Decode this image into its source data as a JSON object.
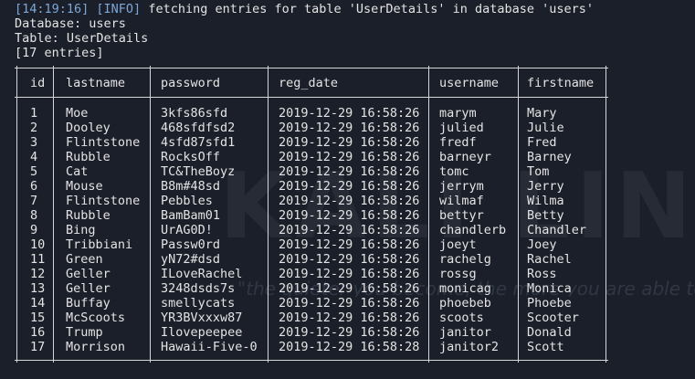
{
  "log": {
    "timestamp": "[14:19:16]",
    "level": "[INFO]",
    "message": "fetching entries for table 'UserDetails' in database 'users'"
  },
  "database_line": "Database: users",
  "table_line": "Table: UserDetails",
  "entries_line": "[17 entries]",
  "table": {
    "headers": [
      "id",
      "lastname",
      "password",
      "reg_date",
      "username",
      "firstname"
    ],
    "rows": [
      [
        "1",
        "Moe",
        "3kfs86sfd",
        "2019-12-29 16:58:26",
        "marym",
        "Mary"
      ],
      [
        "2",
        "Dooley",
        "468sfdfsd2",
        "2019-12-29 16:58:26",
        "julied",
        "Julie"
      ],
      [
        "3",
        "Flintstone",
        "4sfd87sfd1",
        "2019-12-29 16:58:26",
        "fredf",
        "Fred"
      ],
      [
        "4",
        "Rubble",
        "RocksOff",
        "2019-12-29 16:58:26",
        "barneyr",
        "Barney"
      ],
      [
        "5",
        "Cat",
        "TC&TheBoyz",
        "2019-12-29 16:58:26",
        "tomc",
        "Tom"
      ],
      [
        "6",
        "Mouse",
        "B8m#48sd",
        "2019-12-29 16:58:26",
        "jerrym",
        "Jerry"
      ],
      [
        "7",
        "Flintstone",
        "Pebbles",
        "2019-12-29 16:58:26",
        "wilmaf",
        "Wilma"
      ],
      [
        "8",
        "Rubble",
        "BamBam01",
        "2019-12-29 16:58:26",
        "bettyr",
        "Betty"
      ],
      [
        "9",
        "Bing",
        "UrAG0D!",
        "2019-12-29 16:58:26",
        "chandlerb",
        "Chandler"
      ],
      [
        "10",
        "Tribbiani",
        "Passw0rd",
        "2019-12-29 16:58:26",
        "joeyt",
        "Joey"
      ],
      [
        "11",
        "Green",
        "yN72#dsd",
        "2019-12-29 16:58:26",
        "rachelg",
        "Rachel"
      ],
      [
        "12",
        "Geller",
        "ILoveRachel",
        "2019-12-29 16:58:26",
        "rossg",
        "Ross"
      ],
      [
        "13",
        "Geller",
        "3248dsds7s",
        "2019-12-29 16:58:26",
        "monicag",
        "Monica"
      ],
      [
        "14",
        "Buffay",
        "smellycats",
        "2019-12-29 16:58:26",
        "phoebeb",
        "Phoebe"
      ],
      [
        "15",
        "McScoots",
        "YR3BVxxxw87",
        "2019-12-29 16:58:26",
        "scoots",
        "Scooter"
      ],
      [
        "16",
        "Trump",
        "Ilovepeepee",
        "2019-12-29 16:58:26",
        "janitor",
        "Donald"
      ],
      [
        "17",
        "Morrison",
        "Hawaii-Five-0",
        "2019-12-29 16:58:28",
        "janitor2",
        "Scott"
      ]
    ]
  },
  "watermark": {
    "logo_text": "KALI LINUX",
    "tagline": "\"the quieter you become, the more you are able to hear\""
  },
  "colors": {
    "background": "#1b1f29",
    "text": "#e4e4e4",
    "log_accent": "#7ea7d8",
    "watermark": "#2a2f3b"
  }
}
